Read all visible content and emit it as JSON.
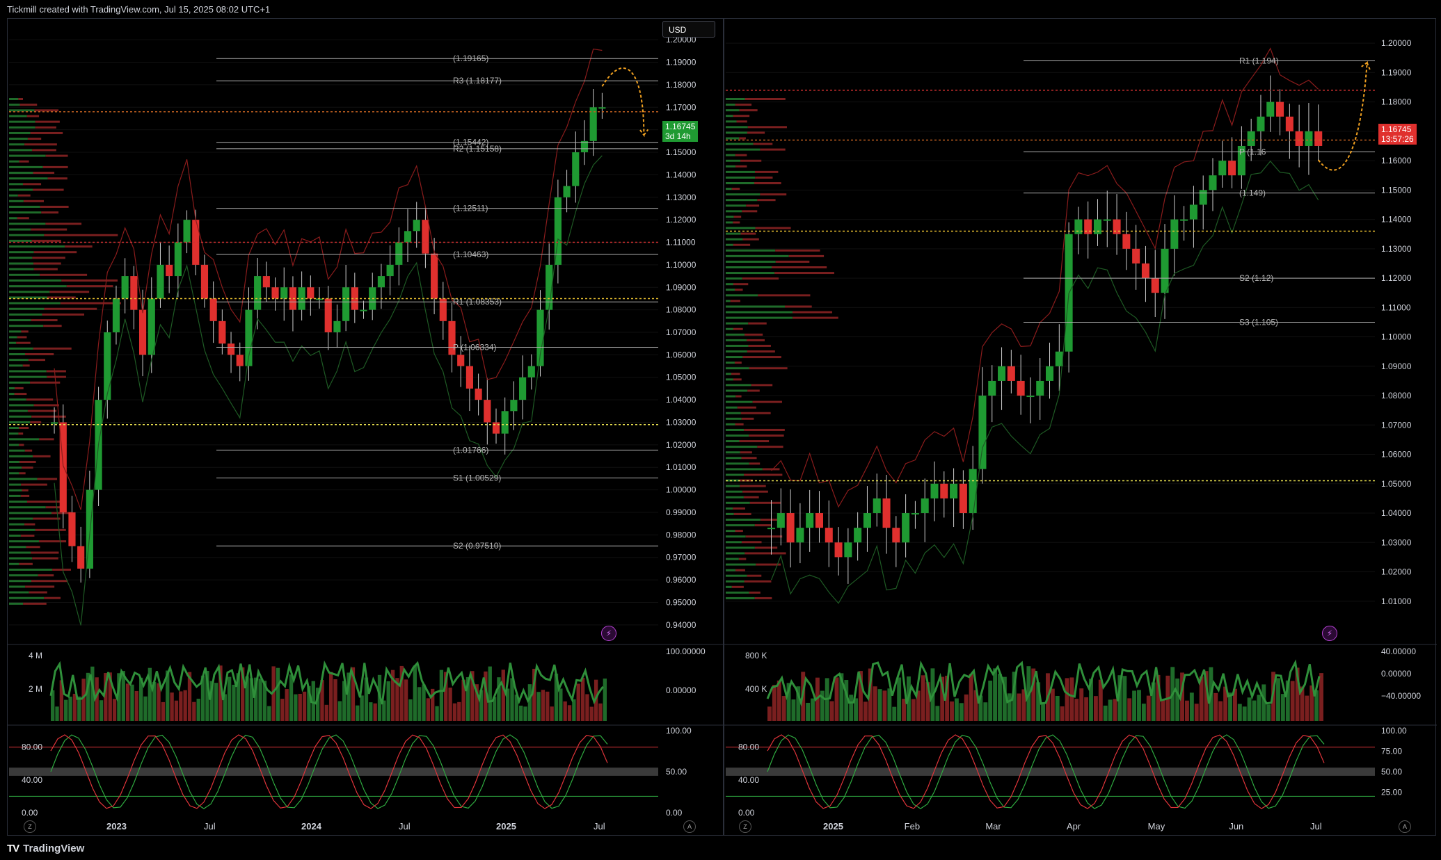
{
  "header": {
    "title": "Tickmill created with TradingView.com, Jul 15, 2025 08:02 UTC+1"
  },
  "footer": {
    "brand": "TradingView",
    "logo": "tradingview-logo"
  },
  "currency_button": "USD",
  "colors": {
    "up": "#1f9a32",
    "down": "#e0302e",
    "grid": "#1a1a1a",
    "bb": "#8b1c1c",
    "channel": "#8a8a8a",
    "orange": "#f0a020",
    "green_line": "#2faa40",
    "red_line": "#e0343a"
  },
  "left": {
    "price_axis": [
      "1.20000",
      "1.19000",
      "1.18000",
      "1.17000",
      "1.16000",
      "1.15000",
      "1.14000",
      "1.13000",
      "1.12000",
      "1.11000",
      "1.10000",
      "1.09000",
      "1.08000",
      "1.07000",
      "1.06000",
      "1.05000",
      "1.04000",
      "1.03000",
      "1.02000",
      "1.01000",
      "1.00000",
      "0.99000",
      "0.98000",
      "0.97000",
      "0.96000",
      "0.95000",
      "0.94000"
    ],
    "time_axis": [
      "2023",
      "Jul",
      "2024",
      "Jul",
      "2025",
      "Jul"
    ],
    "price_badge": {
      "price": "1.16745",
      "countdown": "3d 14h"
    },
    "levels": [
      {
        "label": "(1.19165)",
        "value": 1.19165
      },
      {
        "label": "R3 (1.18177)",
        "value": 1.18177
      },
      {
        "label": "R2 (1.15158)",
        "value": 1.15158
      },
      {
        "label": "(1.15442)",
        "value": 1.15442
      },
      {
        "label": "(1.12511)",
        "value": 1.12511
      },
      {
        "label": "(1.10463)",
        "value": 1.10463
      },
      {
        "label": "R1 (1.08353)",
        "value": 1.08353
      },
      {
        "label": "P (1.06334)",
        "value": 1.06334
      },
      {
        "label": "(1.01766)",
        "value": 1.01766
      },
      {
        "label": "S1 (1.00529)",
        "value": 1.00529
      },
      {
        "label": "S2 (0.97510)",
        "value": 0.9751
      }
    ],
    "volume_axis": [
      "4 M",
      "2 M"
    ],
    "osc_axis": [
      "100.00000",
      "0.00000"
    ],
    "stoch_axis_left": [
      "80.00",
      "40.00",
      "0.00"
    ],
    "stoch_axis_right": [
      "100.00",
      "50.00",
      "0.00"
    ]
  },
  "right": {
    "price_axis": [
      "1.20000",
      "1.19000",
      "1.18000",
      "1.17000",
      "1.16000",
      "1.15000",
      "1.14000",
      "1.13000",
      "1.12000",
      "1.11000",
      "1.10000",
      "1.09000",
      "1.08000",
      "1.07000",
      "1.06000",
      "1.05000",
      "1.04000",
      "1.03000",
      "1.02000",
      "1.01000"
    ],
    "time_axis": [
      "2025",
      "Feb",
      "Mar",
      "Apr",
      "May",
      "Jun",
      "Jul"
    ],
    "price_badge": {
      "price": "1.16745",
      "countdown": "13:57:26"
    },
    "levels": [
      {
        "label": "R1 (1.194)",
        "value": 1.194
      },
      {
        "label": "P (1.16",
        "value": 1.163
      },
      {
        "label": "(1.149)",
        "value": 1.149
      },
      {
        "label": "S2 (1.12)",
        "value": 1.12
      },
      {
        "label": "S3 (1.105)",
        "value": 1.105
      }
    ],
    "volume_axis": [
      "800 K",
      "400 K"
    ],
    "osc_axis": [
      "40.00000",
      "0.00000",
      "−40.00000"
    ],
    "stoch_axis_left": [
      "80.00",
      "40.00",
      "0.00"
    ],
    "stoch_axis_right": [
      "100.00",
      "75.00",
      "50.00",
      "25.00"
    ]
  },
  "chart_data": [
    {
      "type": "candlestick",
      "title": "",
      "xlabel": "",
      "ylabel": "",
      "ylim": [
        0.935,
        1.205
      ],
      "x": [
        "2023",
        "Jul",
        "2024",
        "Jul",
        "2025",
        "Jul"
      ],
      "series": [
        {
          "values": [
            1.03,
            0.99,
            0.975,
            0.965,
            1.0,
            1.04,
            1.07,
            1.085,
            1.095,
            1.08,
            1.06,
            1.085,
            1.1,
            1.095,
            1.11,
            1.12,
            1.1,
            1.085,
            1.075,
            1.065,
            1.06,
            1.055,
            1.08,
            1.095,
            1.09,
            1.085,
            1.09,
            1.08,
            1.09,
            1.085,
            1.085,
            1.07,
            1.075,
            1.09,
            1.08,
            1.08,
            1.09,
            1.095,
            1.1,
            1.11,
            1.115,
            1.12,
            1.105,
            1.085,
            1.075,
            1.06,
            1.055,
            1.045,
            1.04,
            1.03,
            1.025,
            1.035,
            1.04,
            1.05,
            1.055,
            1.08,
            1.1,
            1.13,
            1.135,
            1.15,
            1.155,
            1.17,
            1.17
          ]
        }
      ]
    },
    {
      "type": "candlestick",
      "title": "",
      "xlabel": "",
      "ylabel": "",
      "ylim": [
        1.0,
        1.205
      ],
      "x": [
        "2025",
        "Feb",
        "Mar",
        "Apr",
        "May",
        "Jun",
        "Jul"
      ],
      "series": [
        {
          "values": [
            1.035,
            1.04,
            1.03,
            1.035,
            1.04,
            1.035,
            1.03,
            1.025,
            1.03,
            1.035,
            1.04,
            1.045,
            1.035,
            1.03,
            1.04,
            1.04,
            1.045,
            1.05,
            1.045,
            1.05,
            1.04,
            1.055,
            1.08,
            1.085,
            1.09,
            1.085,
            1.08,
            1.08,
            1.085,
            1.09,
            1.095,
            1.135,
            1.14,
            1.135,
            1.14,
            1.14,
            1.135,
            1.13,
            1.125,
            1.12,
            1.115,
            1.13,
            1.14,
            1.14,
            1.145,
            1.15,
            1.155,
            1.16,
            1.155,
            1.165,
            1.17,
            1.175,
            1.18,
            1.175,
            1.17,
            1.165,
            1.17,
            1.165
          ]
        }
      ]
    }
  ]
}
